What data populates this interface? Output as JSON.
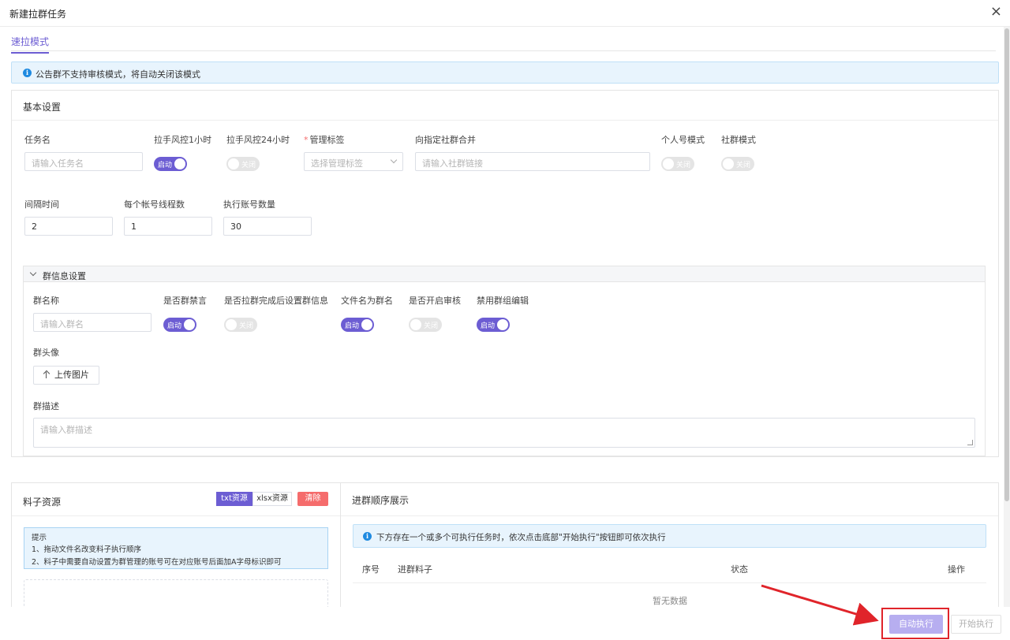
{
  "dialog": {
    "title": "新建拉群任务",
    "close": "×"
  },
  "tabs": [
    {
      "label": "速拉模式",
      "active": true
    }
  ],
  "notice": {
    "icon": "info-icon",
    "text": "公告群不支持审核模式，将自动关闭该模式"
  },
  "basic": {
    "title": "基本设置",
    "task_name": {
      "label": "任务名",
      "placeholder": "请输入任务名"
    },
    "risk_1h": {
      "label": "拉手风控1小时",
      "state": "启动"
    },
    "risk_24h": {
      "label": "拉手风控24小时",
      "state": "关闭"
    },
    "tag": {
      "required": "*",
      "label": "管理标签",
      "placeholder": "选择管理标签"
    },
    "merge": {
      "label": "向指定社群合并",
      "placeholder": "请输入社群链接"
    },
    "personal": {
      "label": "个人号模式",
      "state": "关闭"
    },
    "community": {
      "label": "社群模式",
      "state": "关闭"
    },
    "interval": {
      "label": "间隔时间",
      "value": "2"
    },
    "threads": {
      "label": "每个帐号线程数",
      "value": "1"
    },
    "accounts": {
      "label": "执行账号数量",
      "value": "30"
    }
  },
  "group_info": {
    "title": "群信息设置",
    "name": {
      "label": "群名称",
      "placeholder": "请输入群名"
    },
    "mute": {
      "label": "是否群禁言",
      "state": "启动"
    },
    "set_after": {
      "label": "是否拉群完成后设置群信息",
      "state": "关闭"
    },
    "file_name": {
      "label": "文件名为群名",
      "state": "启动"
    },
    "review": {
      "label": "是否开启审核",
      "state": "关闭"
    },
    "disable_edit": {
      "label": "禁用群组编辑",
      "state": "启动"
    },
    "avatar": {
      "label": "群头像",
      "button": "上传图片"
    },
    "desc": {
      "label": "群描述",
      "placeholder": "请输入群描述"
    }
  },
  "material": {
    "title": "料子资源",
    "seg_txt": "txt资源",
    "seg_xlsx": "xlsx资源",
    "clear": "清除",
    "tip_title": "提示",
    "tip1": "1、拖动文件名改变料子执行顺序",
    "tip2": "2、料子中需要自动设置为群管理的账号可在对应账号后面加A字母标识即可"
  },
  "order": {
    "title": "进群顺序展示",
    "notice": "下方存在一个或多个可执行任务时，依次点击底部\"开始执行\"按钮即可依次执行",
    "col_no": "序号",
    "col_material": "进群料子",
    "col_status": "状态",
    "col_action": "操作",
    "empty": "暂无数据"
  },
  "footer": {
    "auto": "自动执行",
    "start": "开始执行"
  },
  "colors": {
    "accent": "#6c5dd3",
    "danger": "#f56c6c",
    "info": "#1f8ae0",
    "annotation": "#e0242a"
  }
}
